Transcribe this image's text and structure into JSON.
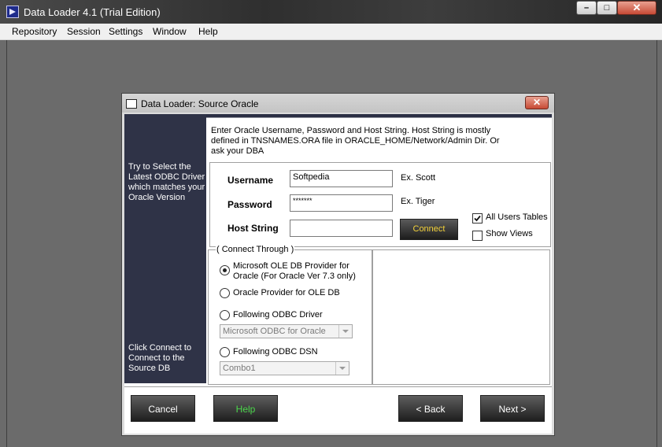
{
  "window": {
    "title": "Data Loader 4.1 (Trial Edition)",
    "min_label": "–",
    "max_label": "□",
    "close_label": "✕"
  },
  "menu": [
    "Repository",
    "Session",
    "Settings",
    "Window",
    "Help"
  ],
  "dialog": {
    "title": "Data Loader: Source Oracle",
    "close_label": "✕",
    "side_top": "Try to Select the Latest ODBC Driver which matches your Oracle Version",
    "side_bottom": "Click Connect to Connect to the Source DB",
    "instructions": "Enter Oracle Username, Password and Host String. Host String is mostly defined in TNSNAMES.ORA file in ORACLE_HOME/Network/Admin Dir. Or ask your DBA",
    "username_label": "Username",
    "username_value": "Softpedia",
    "username_hint": "Ex. Scott",
    "password_label": "Password",
    "password_value": "*******",
    "password_hint": "Ex. Tiger",
    "host_label": "Host String",
    "host_value": "",
    "connect_label": "Connect",
    "all_users_tables_label": "All Users Tables",
    "all_users_tables_checked": true,
    "show_views_label": "Show Views",
    "show_views_checked": false,
    "connect_through_label": "( Connect Through )",
    "options": [
      {
        "label": "Microsoft OLE DB Provider for Oracle (For Oracle Ver 7.3 only)",
        "selected": true
      },
      {
        "label": "Oracle Provider for OLE DB",
        "selected": false
      },
      {
        "label": "Following ODBC Driver",
        "selected": false
      },
      {
        "label": "Following ODBC DSN",
        "selected": false
      }
    ],
    "odbc_driver_value": "Microsoft ODBC for Oracle",
    "odbc_dsn_value": "Combo1",
    "cancel_label": "Cancel",
    "help_label": "Help",
    "back_label": "< Back",
    "next_label": "Next >",
    "help_color": "#4cd64c",
    "connect_color": "#f4d23a"
  }
}
